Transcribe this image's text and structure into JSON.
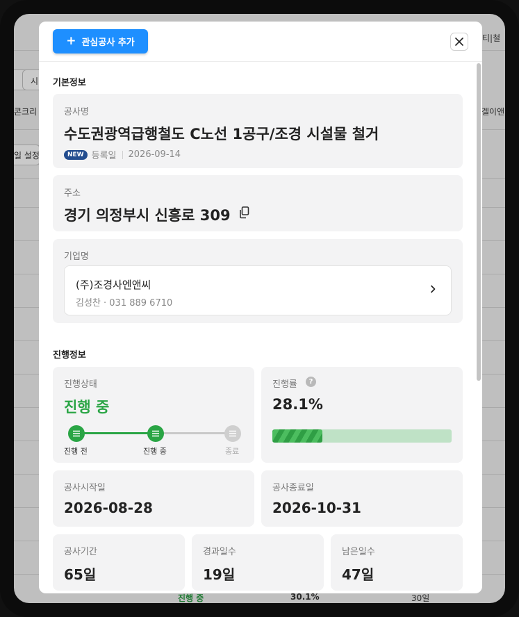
{
  "header": {
    "add_button_label": "관심공사 추가"
  },
  "background": {
    "top_right_text": "티|철",
    "left_tab": "시",
    "left_text": "콘크리",
    "right_text": "겔이앤",
    "settings_text": "일 설정",
    "bottom_status": "진행 중",
    "bottom_rate": "30.1%",
    "bottom_days": "30일"
  },
  "basic_info": {
    "section_title": "기본정보",
    "project_name_label": "공사명",
    "project_name": "수도권광역급행철도 C노선 1공구/조경 시설물 철거",
    "new_badge": "NEW",
    "registered_label": "등록일",
    "registered_date": "2026-09-14",
    "address_label": "주소",
    "address": "경기 의정부시 신흥로 309",
    "company_label": "기업명",
    "company_name": "(주)조경사엔앤씨",
    "company_contact": "김성찬 · 031 889 6710"
  },
  "progress_info": {
    "section_title": "진행정보",
    "status_label": "진행상태",
    "status_value": "진행 중",
    "steps": [
      {
        "label": "진행 전",
        "state": "done"
      },
      {
        "label": "진행 중",
        "state": "done"
      },
      {
        "label": "종료",
        "state": "todo"
      }
    ],
    "rate_label": "진행률",
    "rate_value": "28.1%",
    "rate_fraction": 0.281,
    "start_label": "공사시작일",
    "start_date": "2026-08-28",
    "end_label": "공사종료일",
    "end_date": "2026-10-31",
    "period_label": "공사기간",
    "period_value": "65일",
    "elapsed_label": "경과일수",
    "elapsed_value": "19일",
    "remaining_label": "남은일수",
    "remaining_value": "47일"
  },
  "colors": {
    "accent": "#1e8fff",
    "status_green": "#2aa545",
    "badge_navy": "#234d8f"
  }
}
